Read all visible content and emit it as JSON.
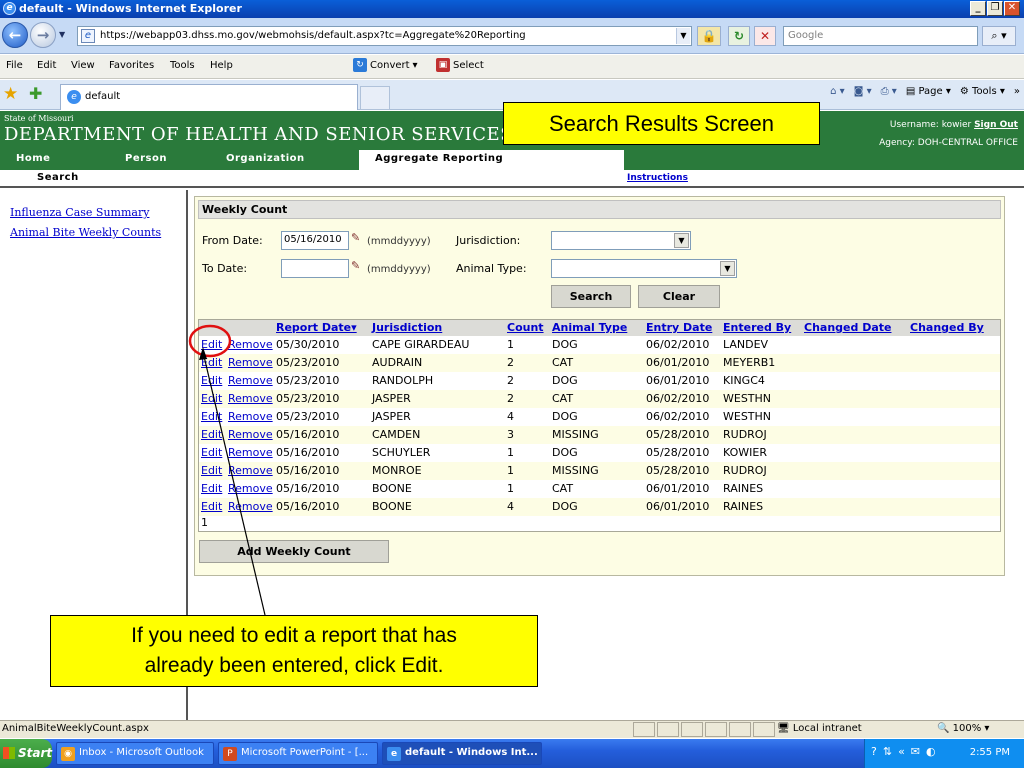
{
  "window": {
    "title": "default - Windows Internet Explorer",
    "minimize": "_",
    "restore": "❐",
    "close": "✕"
  },
  "address_bar": {
    "url": "https://webapp03.dhss.mo.gov/webmohsis/default.aspx?tc=Aggregate%20Reporting",
    "search_placeholder": "Google"
  },
  "menu": {
    "items": [
      "File",
      "Edit",
      "View",
      "Favorites",
      "Tools",
      "Help"
    ],
    "convert": "Convert",
    "select": "Select"
  },
  "tabbar": {
    "tab_label": "default",
    "page": "Page",
    "tools": "Tools"
  },
  "site": {
    "state": "State of Missouri",
    "department": "DEPARTMENT OF HEALTH AND SENIOR SERVICES",
    "username_label": "Username:",
    "username": "kowier",
    "sign_out": "Sign Out",
    "agency_label": "Agency:",
    "agency": "DOH-CENTRAL OFFICE",
    "header_color": "#2a7a3b"
  },
  "nav": {
    "tabs": [
      "Home",
      "Person",
      "Organization",
      "Aggregate Reporting"
    ],
    "active": "Aggregate Reporting",
    "sub_search": "Search",
    "instructions": "Instructions"
  },
  "sidebar": {
    "links": [
      "Influenza Case Summary",
      "Animal Bite Weekly Counts"
    ]
  },
  "form": {
    "title": "Weekly Count",
    "from_date_label": "From Date:",
    "from_date_value": "05/16/2010",
    "to_date_label": "To Date:",
    "to_date_value": "",
    "date_hint": "(mmddyyyy)",
    "jurisdiction_label": "Jurisdiction:",
    "animal_type_label": "Animal Type:",
    "search_button": "Search",
    "clear_button": "Clear",
    "add_button": "Add Weekly Count"
  },
  "grid": {
    "columns": [
      "Report Date▾",
      "Jurisdiction",
      "Count",
      "Animal Type",
      "Entry Date",
      "Entered By",
      "Changed Date",
      "Changed By"
    ],
    "edit_label": "Edit",
    "remove_label": "Remove",
    "rows": [
      {
        "report_date": "05/30/2010",
        "jurisdiction": "CAPE GIRARDEAU",
        "count": "1",
        "animal_type": "DOG",
        "entry_date": "06/02/2010",
        "entered_by": "LANDEV"
      },
      {
        "report_date": "05/23/2010",
        "jurisdiction": "AUDRAIN",
        "count": "2",
        "animal_type": "CAT",
        "entry_date": "06/01/2010",
        "entered_by": "MEYERB1"
      },
      {
        "report_date": "05/23/2010",
        "jurisdiction": "RANDOLPH",
        "count": "2",
        "animal_type": "DOG",
        "entry_date": "06/01/2010",
        "entered_by": "KINGC4"
      },
      {
        "report_date": "05/23/2010",
        "jurisdiction": "JASPER",
        "count": "2",
        "animal_type": "CAT",
        "entry_date": "06/02/2010",
        "entered_by": "WESTHN"
      },
      {
        "report_date": "05/23/2010",
        "jurisdiction": "JASPER",
        "count": "4",
        "animal_type": "DOG",
        "entry_date": "06/02/2010",
        "entered_by": "WESTHN"
      },
      {
        "report_date": "05/16/2010",
        "jurisdiction": "CAMDEN",
        "count": "3",
        "animal_type": "MISSING",
        "entry_date": "05/28/2010",
        "entered_by": "RUDROJ"
      },
      {
        "report_date": "05/16/2010",
        "jurisdiction": "SCHUYLER",
        "count": "1",
        "animal_type": "DOG",
        "entry_date": "05/28/2010",
        "entered_by": "KOWIER"
      },
      {
        "report_date": "05/16/2010",
        "jurisdiction": "MONROE",
        "count": "1",
        "animal_type": "MISSING",
        "entry_date": "05/28/2010",
        "entered_by": "RUDROJ"
      },
      {
        "report_date": "05/16/2010",
        "jurisdiction": "BOONE",
        "count": "1",
        "animal_type": "CAT",
        "entry_date": "06/01/2010",
        "entered_by": "RAINES"
      },
      {
        "report_date": "05/16/2010",
        "jurisdiction": "BOONE",
        "count": "4",
        "animal_type": "DOG",
        "entry_date": "06/01/2010",
        "entered_by": "RAINES"
      }
    ],
    "pager": "1"
  },
  "callouts": {
    "top": "Search Results Screen",
    "bottom_line1": "If you need to edit a report that has",
    "bottom_line2": "already been entered, click Edit."
  },
  "statusbar": {
    "text": "AnimalBiteWeeklyCount.aspx",
    "zone": "Local intranet",
    "zoom": "100%"
  },
  "taskbar": {
    "start": "Start",
    "items": [
      "Inbox - Microsoft Outlook",
      "Microsoft PowerPoint - [...",
      "default - Windows Int..."
    ],
    "clock": "2:55 PM"
  }
}
